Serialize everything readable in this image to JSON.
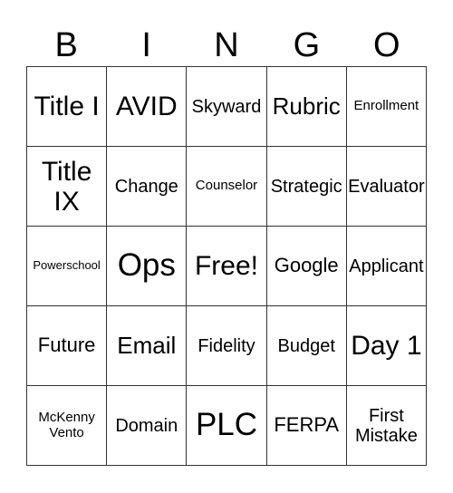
{
  "header": {
    "letters": [
      "B",
      "I",
      "N",
      "G",
      "O"
    ]
  },
  "cells": [
    "Title I",
    "AVID",
    "Skyward",
    "Rubric",
    "Enrollment",
    "Title IX",
    "Change",
    "Counselor",
    "Strategic",
    "Evaluator",
    "Powerschool",
    "Ops",
    "Free!",
    "Google",
    "Applicant",
    "Future",
    "Email",
    "Fidelity",
    "Budget",
    "Day 1",
    "McKenny Vento",
    "Domain",
    "PLC",
    "FERPA",
    "First Mistake"
  ]
}
